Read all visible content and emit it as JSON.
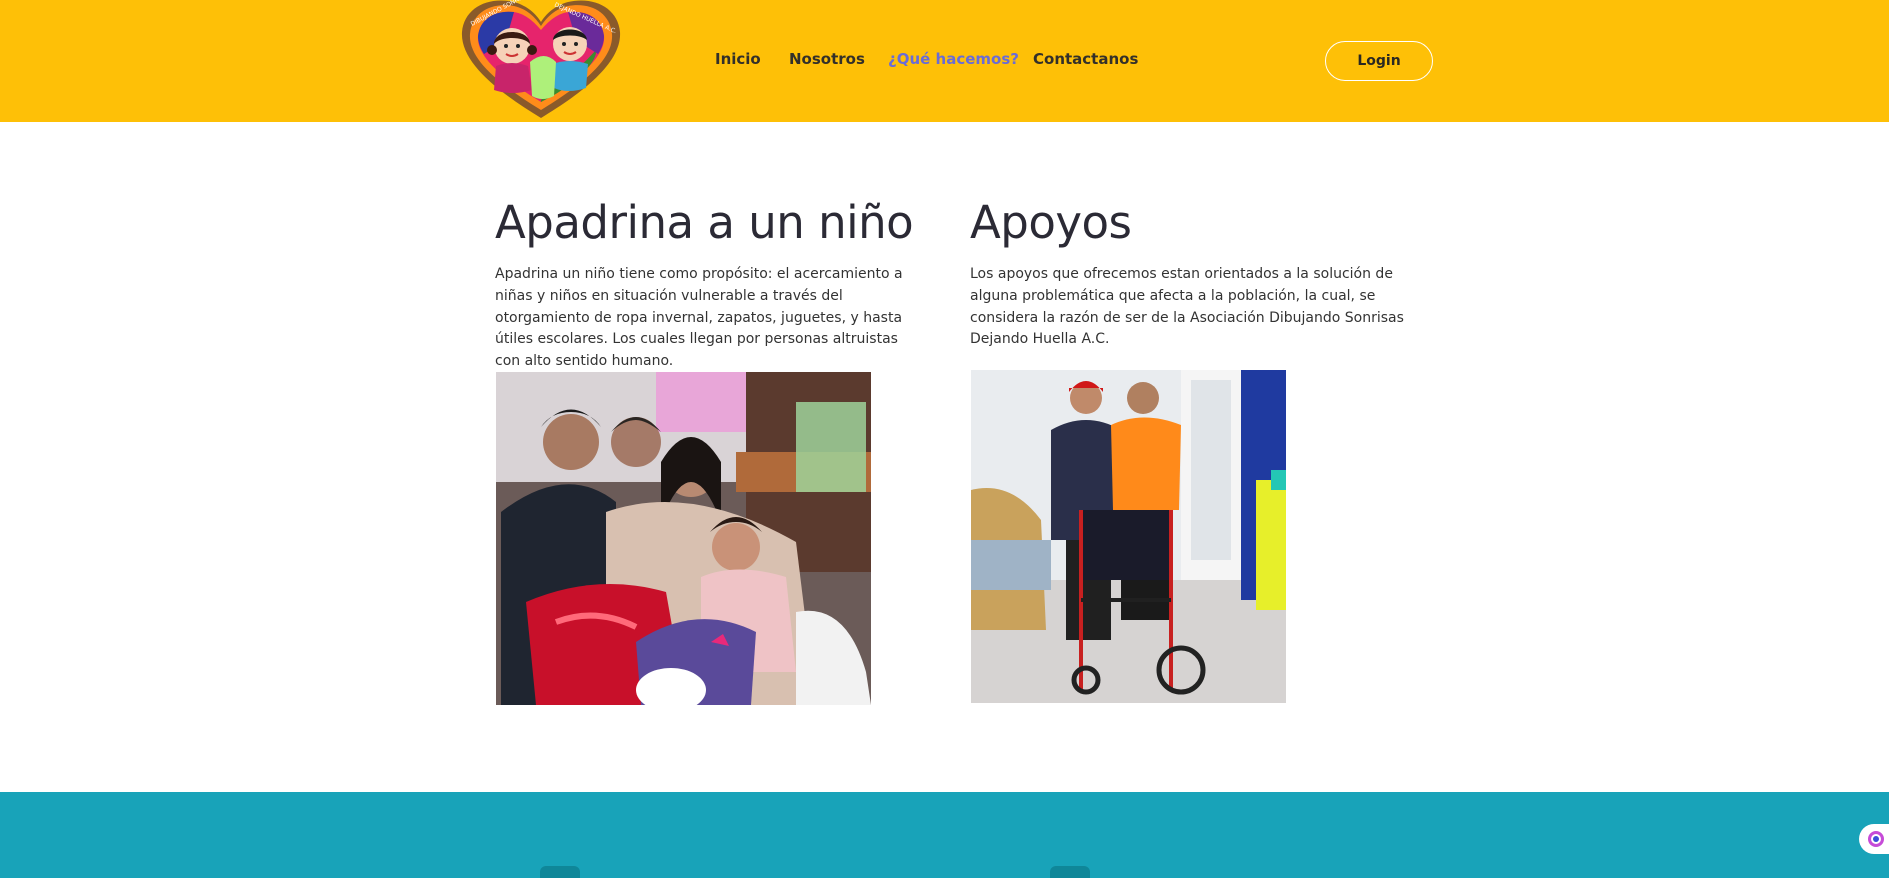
{
  "header": {
    "logo": {
      "text_left": "DIBUJANDO SONRISAS",
      "text_right": "DEJANDO HUELLA A.C."
    },
    "nav": [
      {
        "label": "Inicio",
        "active": false
      },
      {
        "label": "Nosotros",
        "active": false
      },
      {
        "label": "¿Qué hacemos?",
        "active": true
      },
      {
        "label": "Contactanos",
        "active": false
      }
    ],
    "login_label": "Login"
  },
  "sections": [
    {
      "title": "Apadrina a un niño",
      "text": "Apadrina un niño tiene como propósito: el acercamiento a niñas y niños en situación vulnerable a través del otorgamiento de ropa invernal, zapatos, juguetes, y hasta útiles escolares. Los cuales llegan por personas altruistas con alto sentido humano."
    },
    {
      "title": "Apoyos",
      "text": "Los apoyos que ofrecemos estan orientados a la solución de alguna problemática que afecta a la población, la cual, se considera la razón de ser de la Asociación Dibujando Sonrisas Dejando Huella A.C."
    }
  ],
  "colors": {
    "header_bg": "#fec007",
    "nav_active": "#6a6cd6",
    "footer_bg": "#18a3b9"
  },
  "icons": [
    "logo-heart",
    "family-photo",
    "wheelchair-photo",
    "accessibility-icon"
  ]
}
